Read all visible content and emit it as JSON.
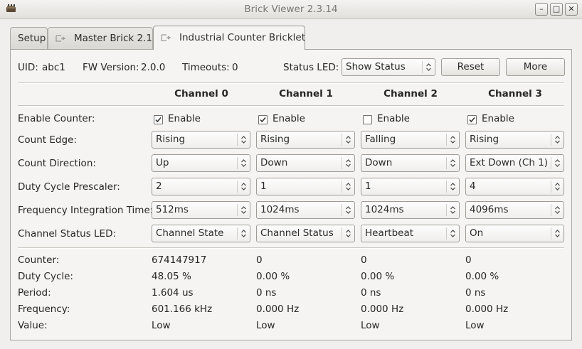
{
  "window": {
    "title": "Brick Viewer 2.3.14"
  },
  "tabs": [
    {
      "label": "Setup"
    },
    {
      "label": "Master Brick 2.1"
    },
    {
      "label": "Industrial Counter Bricklet"
    }
  ],
  "info": {
    "uid_label": "UID:",
    "uid": "abc1",
    "fw_label": "FW Version:",
    "fw": "2.0.0",
    "timeouts_label": "Timeouts:",
    "timeouts": "0",
    "status_led_label": "Status LED:",
    "status_led": "Show Status",
    "reset": "Reset",
    "more": "More"
  },
  "channels": [
    "Channel 0",
    "Channel 1",
    "Channel 2",
    "Channel 3"
  ],
  "settings": {
    "enable_label": "Enable Counter:",
    "enable_text": "Enable",
    "enabled": [
      true,
      true,
      false,
      true
    ],
    "rows": [
      {
        "label": "Count Edge:",
        "values": [
          "Rising",
          "Rising",
          "Falling",
          "Rising"
        ]
      },
      {
        "label": "Count Direction:",
        "values": [
          "Up",
          "Down",
          "Down",
          "Ext Down (Ch 1)"
        ]
      },
      {
        "label": "Duty Cycle Prescaler:",
        "values": [
          "2",
          "1",
          "1",
          "4"
        ]
      },
      {
        "label": "Frequency Integration Time:",
        "values": [
          "512ms",
          "1024ms",
          "1024ms",
          "4096ms"
        ]
      },
      {
        "label": "Channel Status LED:",
        "values": [
          "Channel State",
          "Channel Status",
          "Heartbeat",
          "On"
        ]
      }
    ]
  },
  "readings": [
    {
      "label": "Counter:",
      "values": [
        "674147917",
        "0",
        "0",
        "0"
      ]
    },
    {
      "label": "Duty Cycle:",
      "values": [
        "48.05 %",
        "0.00 %",
        "0.00 %",
        "0.00 %"
      ]
    },
    {
      "label": "Period:",
      "values": [
        "1.604 us",
        "0 ns",
        "0 ns",
        "0 ns"
      ]
    },
    {
      "label": "Frequency:",
      "values": [
        "601.166 kHz",
        "0.000 Hz",
        "0.000 Hz",
        "0.000 Hz"
      ]
    },
    {
      "label": "Value:",
      "values": [
        "Low",
        "Low",
        "Low",
        "Low"
      ]
    }
  ],
  "icons": {
    "app": "brick-icon",
    "window_controls": [
      "minimize-icon",
      "maximize-icon",
      "close-icon"
    ],
    "tab": "tab-connect-icon",
    "combo_arrow": "updown-chevron-icon",
    "checkbox": "checkmark-icon"
  },
  "colors": {
    "window_bg": "#f0efed",
    "panel_bg": "#f5f4f2",
    "border": "#a9a6a1"
  }
}
